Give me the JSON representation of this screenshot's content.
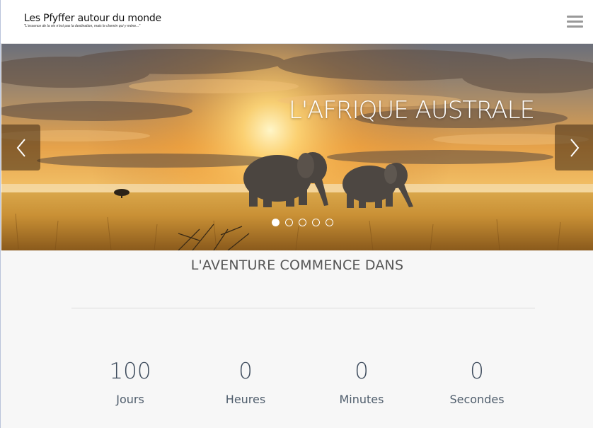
{
  "header": {
    "brand_title": "Les Pfyffer autour du monde",
    "brand_tagline": "\"L'essence de la vie n'est pas la destination, mais le chemin qui y mène...\"",
    "menu_icon": "hamburger-menu-icon"
  },
  "carousel": {
    "caption": "L'AFRIQUE AUSTRALE",
    "prev_icon": "chevron-left-icon",
    "next_icon": "chevron-right-icon",
    "slide_count": 5,
    "active_index": 0
  },
  "countdown": {
    "title": "L'AVENTURE COMMENCE DANS",
    "items": [
      {
        "value": "100",
        "label": "Jours"
      },
      {
        "value": "0",
        "label": "Heures"
      },
      {
        "value": "0",
        "label": "Minutes"
      },
      {
        "value": "0",
        "label": "Secondes"
      }
    ]
  },
  "colors": {
    "accent_text": "#3d4b5c",
    "header_bg": "#ffffff",
    "page_bg": "#f7f7f7"
  }
}
